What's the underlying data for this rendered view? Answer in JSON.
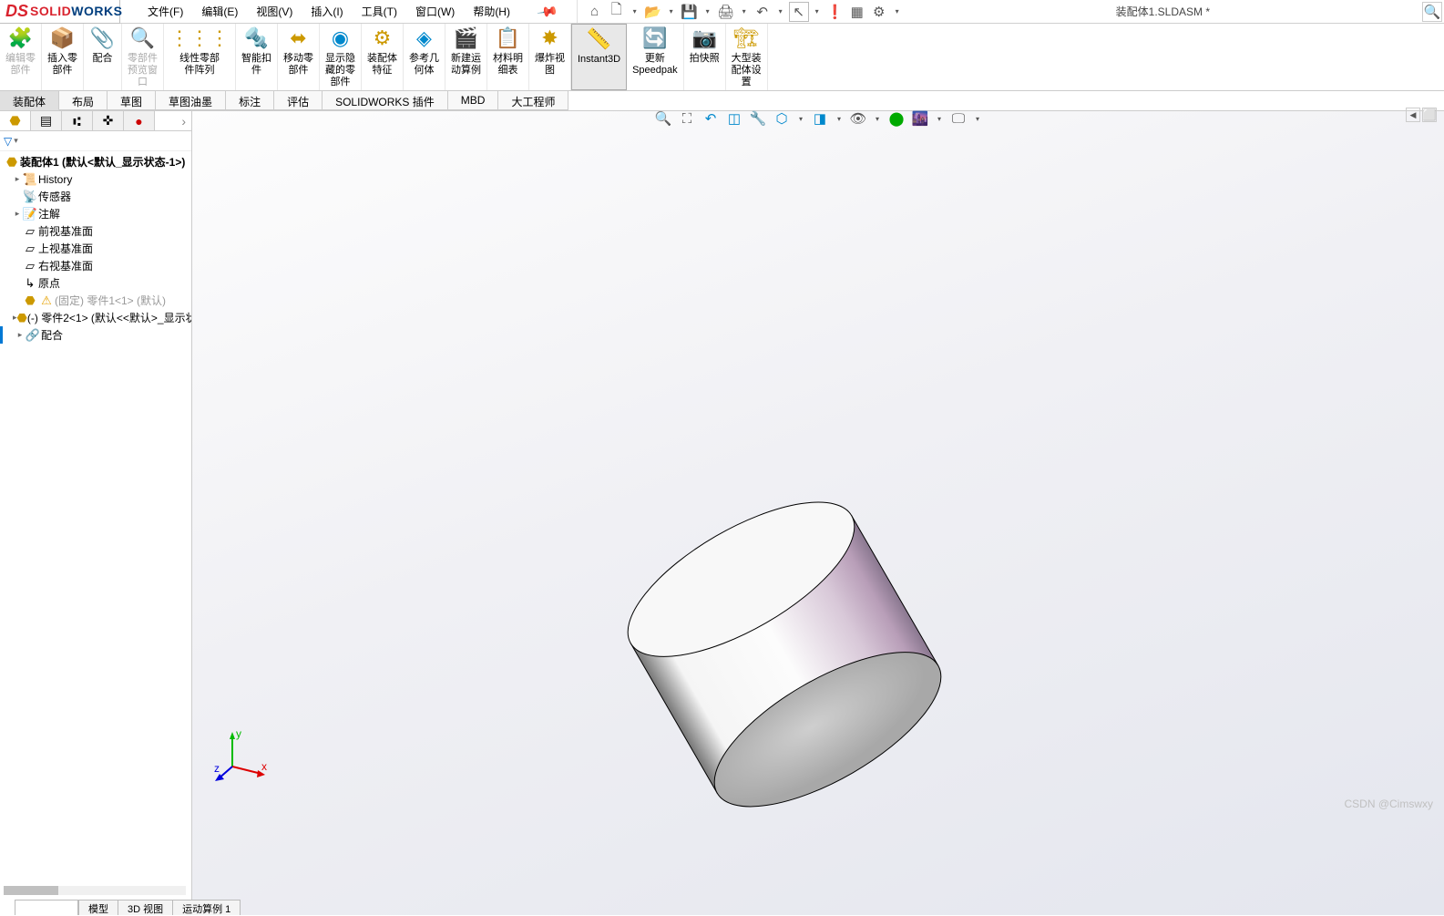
{
  "app": {
    "title": "装配体1.SLDASM *",
    "logo_solid": "SOLID",
    "logo_works": "WORKS"
  },
  "menu": [
    "文件(F)",
    "编辑(E)",
    "视图(V)",
    "插入(I)",
    "工具(T)",
    "窗口(W)",
    "帮助(H)"
  ],
  "ribbon": [
    {
      "label": "编辑零\n部件",
      "icon": "🧩",
      "dim": true
    },
    {
      "label": "插入零\n部件",
      "icon": "📦"
    },
    {
      "label": "配合",
      "icon": "📎"
    },
    {
      "label": "零部件\n预览窗\n口",
      "icon": "🔍",
      "dim": true
    },
    {
      "label": "线性零部\n件阵列",
      "icon": "⋮⋮"
    },
    {
      "label": "智能扣\n件",
      "icon": "🔩"
    },
    {
      "label": "移动零\n部件",
      "icon": "↔"
    },
    {
      "label": "显示隐\n藏的零\n部件",
      "icon": "👁"
    },
    {
      "label": "装配体\n特征",
      "icon": "⚙"
    },
    {
      "label": "参考几\n何体",
      "icon": "◆"
    },
    {
      "label": "新建运\n动算例",
      "icon": "🎬"
    },
    {
      "label": "材料明\n细表",
      "icon": "📋"
    },
    {
      "label": "爆炸视\n图",
      "icon": "💥"
    },
    {
      "label": "Instant3D",
      "icon": "📐",
      "active": true
    },
    {
      "label": "更新\nSpeedpak",
      "icon": "🔄"
    },
    {
      "label": "拍快照",
      "icon": "📷"
    },
    {
      "label": "大型装\n配体设\n置",
      "icon": "🏗"
    }
  ],
  "tabs": [
    "装配体",
    "布局",
    "草图",
    "草图油墨",
    "标注",
    "评估",
    "SOLIDWORKS 插件",
    "MBD",
    "大工程师"
  ],
  "active_tab": 0,
  "tree": {
    "root": "装配体1 (默认<默认_显示状态-1>)",
    "items": [
      {
        "label": "History",
        "icon": "📜",
        "expand": true
      },
      {
        "label": "传感器",
        "icon": "📡"
      },
      {
        "label": "注解",
        "icon": "📝",
        "expand": true
      },
      {
        "label": "前视基准面",
        "icon": "▱"
      },
      {
        "label": "上视基准面",
        "icon": "▱"
      },
      {
        "label": "右视基准面",
        "icon": "▱"
      },
      {
        "label": "原点",
        "icon": "↳"
      },
      {
        "label": "(固定) 零件1<1> (默认)",
        "icon": "⚠",
        "dim": true
      },
      {
        "label": "(-) 零件2<1> (默认<<默认>_显示状",
        "icon": "🟡",
        "expand": true
      },
      {
        "label": "配合",
        "icon": "🔗",
        "expand": true
      }
    ]
  },
  "bottom_tabs": [
    "模型",
    "3D 视图",
    "运动算例 1"
  ],
  "watermark": "CSDN @Cimswxy",
  "triad": {
    "x": "x",
    "y": "y",
    "z": "z"
  }
}
